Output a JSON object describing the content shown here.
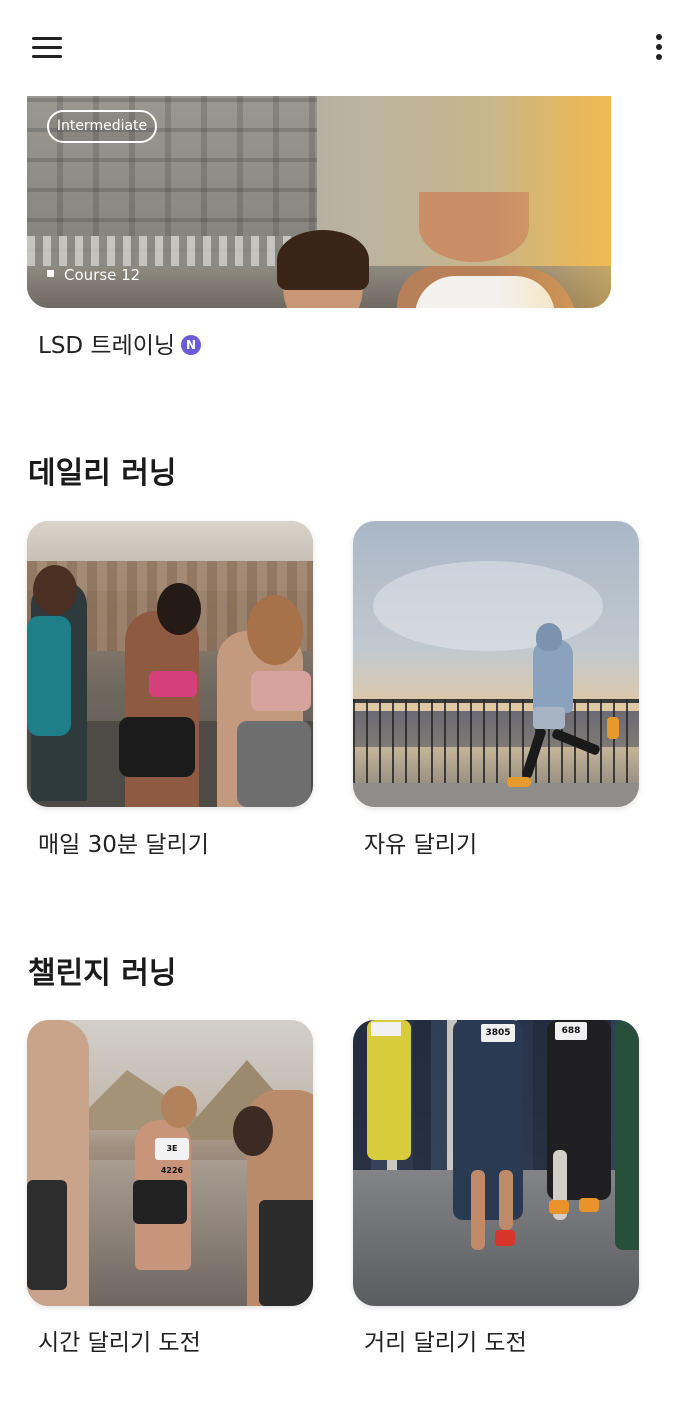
{
  "featured": {
    "level": "Intermediate",
    "course": "Course 12",
    "title": "LSD 트레이닝",
    "new_badge": "N"
  },
  "sections": [
    {
      "title": "데일리 러닝",
      "cards": [
        {
          "label": "매일 30분 달리기"
        },
        {
          "label": "자유 달리기"
        }
      ]
    },
    {
      "title": "챌린지 러닝",
      "cards": [
        {
          "label": "시간 달리기 도전"
        },
        {
          "label": "거리 달리기 도전"
        }
      ]
    }
  ],
  "photo_bibs": {
    "runner_a": "3805",
    "runner_b": "688",
    "cheer_runner": "3E 4226"
  },
  "icons": {
    "menu": "hamburger-menu-icon",
    "more": "more-vertical-icon"
  },
  "colors": {
    "new_badge": "#6b5bd6",
    "text": "#1b1b1b"
  }
}
